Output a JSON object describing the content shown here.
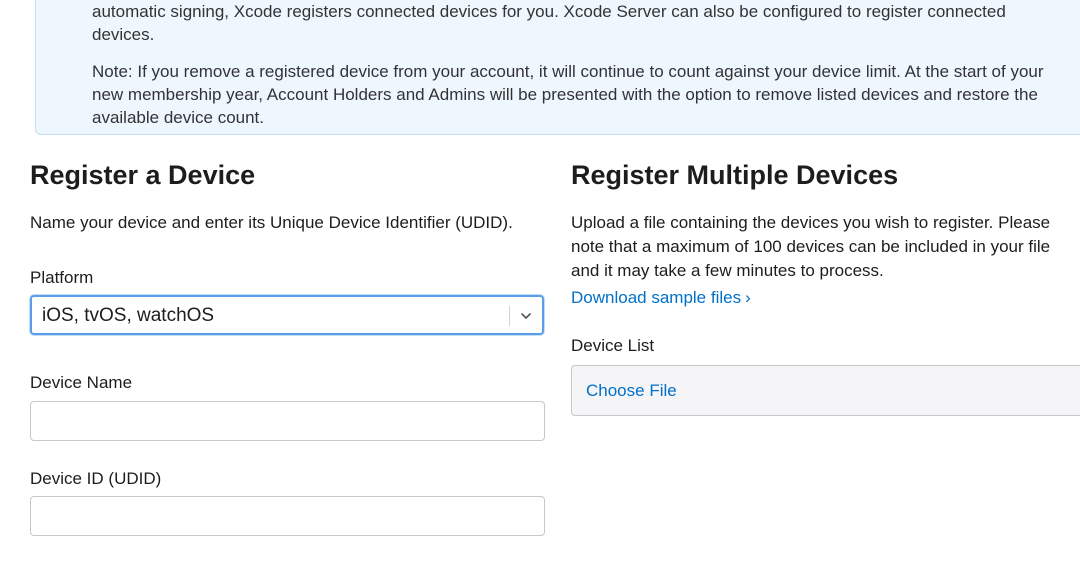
{
  "info": {
    "paragraph1": "automatic signing, Xcode registers connected devices for you. Xcode Server can also be configured to register connected devices.",
    "paragraph2": "Note: If you remove a registered device from your account, it will continue to count against your device limit. At the start of your new membership year, Account Holders and Admins will be presented with the option to remove listed devices and restore the available device count."
  },
  "register_device": {
    "heading": "Register a Device",
    "description": "Name your device and enter its Unique Device Identifier (UDID).",
    "platform_label": "Platform",
    "platform_value": "iOS, tvOS, watchOS",
    "device_name_label": "Device Name",
    "device_name_value": "",
    "device_id_label": "Device ID (UDID)",
    "device_id_value": ""
  },
  "register_multiple": {
    "heading": "Register Multiple Devices",
    "description": "Upload a file containing the devices you wish to register. Please\nnote that a maximum of 100 devices can be included in your file\nand it may take a few minutes to process.",
    "download_link": "Download sample files",
    "download_chevron": "›",
    "device_list_label": "Device List",
    "choose_file_label": "Choose File"
  },
  "icons": {
    "select_arrow": "chevron-down-icon",
    "link_arrow": "chevron-right-icon"
  },
  "colors": {
    "accent": "#0070c9",
    "info_background": "#eef7fd",
    "focus_border": "#5b9ee8"
  }
}
